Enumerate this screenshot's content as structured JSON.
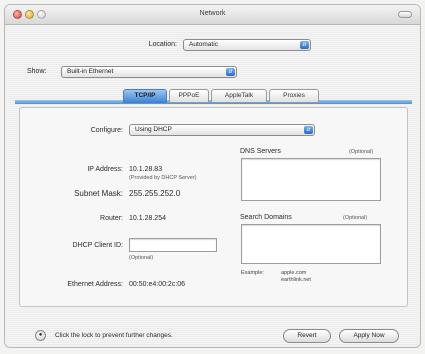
{
  "window": {
    "title": "Network"
  },
  "location": {
    "label": "Location:",
    "value": "Automatic"
  },
  "show": {
    "label": "Show:",
    "value": "Built-in Ethernet"
  },
  "tabs": [
    {
      "label": "TCP/IP"
    },
    {
      "label": "PPPoE"
    },
    {
      "label": "AppleTalk"
    },
    {
      "label": "Proxies"
    }
  ],
  "configure": {
    "label": "Configure:",
    "value": "Using DHCP"
  },
  "ip": {
    "label": "IP Address:",
    "value": "10.1.28.83",
    "note": "(Provided by DHCP Server)"
  },
  "subnet": {
    "label": "Subnet Mask:",
    "value": "255.255.252.0"
  },
  "router": {
    "label": "Router:",
    "value": "10.1.28.254"
  },
  "dhcp_client_id": {
    "label": "DHCP Client ID:",
    "value": "",
    "note": "(Optional)"
  },
  "ethernet": {
    "label": "Ethernet Address:",
    "value": "00:50:e4:00:2c:06"
  },
  "dns": {
    "label": "DNS Servers",
    "optional": "(Optional)"
  },
  "search_domains": {
    "label": "Search Domains",
    "optional": "(Optional)"
  },
  "example": {
    "label": "Example:",
    "line1": "apple.com",
    "line2": "earthlink.net"
  },
  "footer": {
    "lock_text": "Click the lock to prevent further changes.",
    "revert": "Revert",
    "apply": "Apply Now"
  }
}
